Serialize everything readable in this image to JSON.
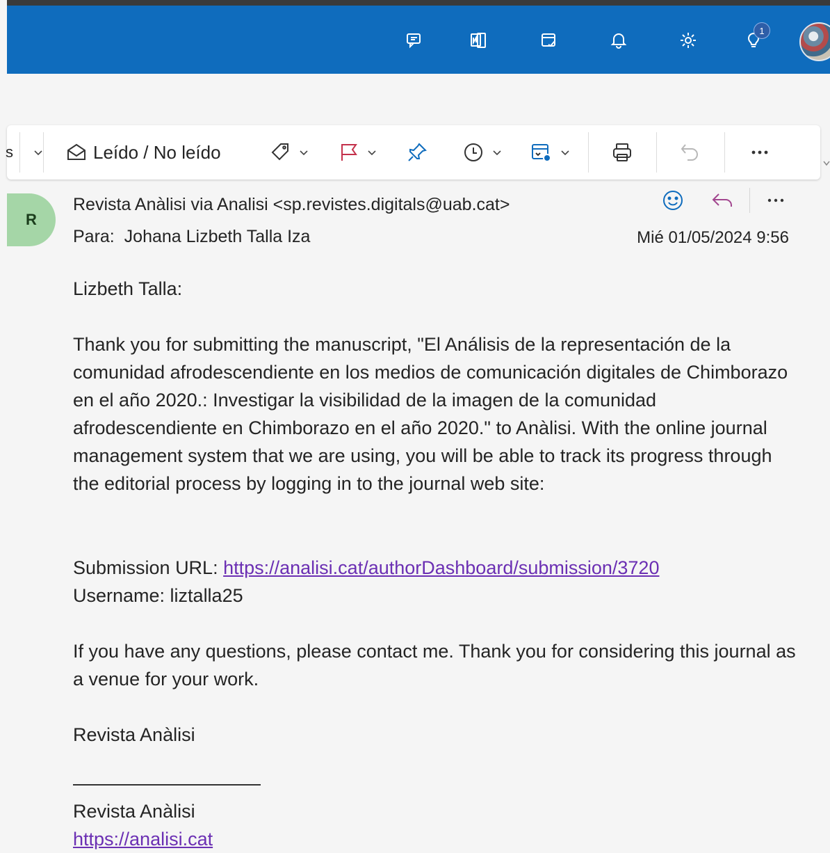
{
  "topbar": {
    "icons": [
      "feedback-chat-icon",
      "onenote-icon",
      "my-day-icon",
      "bell-icon",
      "gear-icon",
      "lightbulb-icon"
    ],
    "tips_badge": "1",
    "accent": "#0f6cbd"
  },
  "toolbar": {
    "partial_label": "s",
    "read_unread_label": "Leído / No leído",
    "flag_color": "#c4314b",
    "pin_color": "#0f6cbd"
  },
  "message": {
    "sender_initial": "R",
    "from": "Revista Anàlisi via Analisi <sp.revistes.digitals@uab.cat>",
    "to_label": "Para:",
    "to_name": "Johana Lizbeth Talla Iza",
    "date": "Mié 01/05/2024 9:56",
    "greeting": "Lizbeth Talla:",
    "body_paragraph": "Thank you for submitting the manuscript, \"El Análisis de la representación de la comunidad afrodescendiente en los medios de comunicación digitales de Chimborazo en el año 2020.: Investigar la visibilidad de la imagen de la comunidad afrodescendiente en Chimborazo en el año 2020.\" to Anàlisi. With the online journal management system that we are using, you will be able to track its progress through the editorial process by logging in to the journal web site:",
    "submission_label": "Submission URL:",
    "submission_url": "https://analisi.cat/authorDashboard/submission/3720",
    "username_line": "Username: liztalla25",
    "questions_paragraph": "If you have any questions, please contact me. Thank you for considering this journal as a venue for your work.",
    "signoff": "Revista Anàlisi",
    "signature_name": "Revista Anàlisi",
    "signature_url": "https://analisi.cat"
  }
}
